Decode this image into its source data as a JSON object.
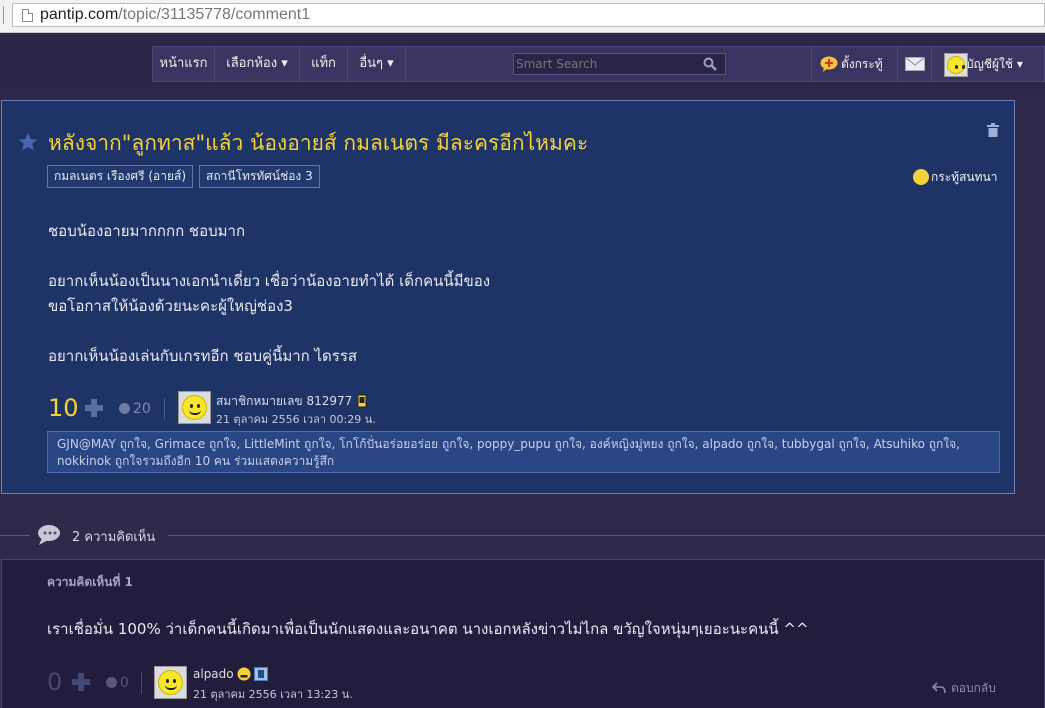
{
  "browser": {
    "url_host": "pantip.com",
    "url_path": "/topic/31135778/comment1"
  },
  "nav": {
    "items": [
      "หน้าแรก",
      "เลือกห้อง ▾",
      "แท็ก",
      "อื่นๆ ▾"
    ],
    "search_placeholder": "Smart Search",
    "create_topic": "ตั้งกระทู้",
    "account": "บัญชีผู้ใช้ ▾"
  },
  "post": {
    "title": "หลังจาก\"ลูกทาส\"แล้ว น้องอายส์ กมลเนตร มีละครอีกไหมคะ",
    "tags": [
      "กมลเนตร เรืองศรี (อายส์)",
      "สถานีโทรทัศน์ช่อง 3"
    ],
    "type_label": "กระทู้สนทนา",
    "body_lines": [
      "ชอบน้องอายมากกกก ชอบมาก",
      "",
      "อยากเห็นน้องเป็นนางเอกนำเดี่ยว เชื่อว่าน้องอายทำได้ เด็กคนนี้มีของ",
      "ขอโอกาสให้น้องด้วยนะคะผู้ใหญ่ช่อง3",
      "",
      "อยากเห็นน้องเล่นกับเกรทอีก ชอบคู่นี้มาก ไดรรส"
    ],
    "score": "10",
    "emotion_count": "20",
    "author": "สมาชิกหมายเลข 812977",
    "date": "21 ตุลาคม 2556 เวลา 00:29 น.",
    "likes_line1": "GJN@MAY ถูกใจ, Grimace ถูกใจ, LittleMint ถูกใจ, โกโก้ปั่นอร่อยอร่อย ถูกใจ, poppy_pupu ถูกใจ, องค์หญิงมู่หยง ถูกใจ, alpado ถูกใจ, tubbygal ถูกใจ, Atsuhiko ถูกใจ,",
    "likes_line2": "nokkinok ถูกใจรวมถึงอีก 10 คน ร่วมแสดงความรู้สึก"
  },
  "comments_header": {
    "count_label": "2 ความคิดเห็น"
  },
  "comment1": {
    "number_label": "ความคิดเห็นที่ 1",
    "text": "เราเชื่อมั่น 100% ว่าเด็กคนนี้เกิดมาเพื่อเป็นนักแสดงและอนาคต นางเอกหลังข่าวไม่ไกล ขวัญใจหนุ่มๆเยอะนะคนนี้ ^^",
    "score": "0",
    "emotion_count": "0",
    "author": "alpado",
    "date": "21 ตุลาคม 2556 เวลา 13:23 น.",
    "reply_label": "ตอบกลับ"
  },
  "colors": {
    "title_yellow": "#f5d23a",
    "post_bg": "#1f3466",
    "page_bg": "#2f2a4a"
  }
}
